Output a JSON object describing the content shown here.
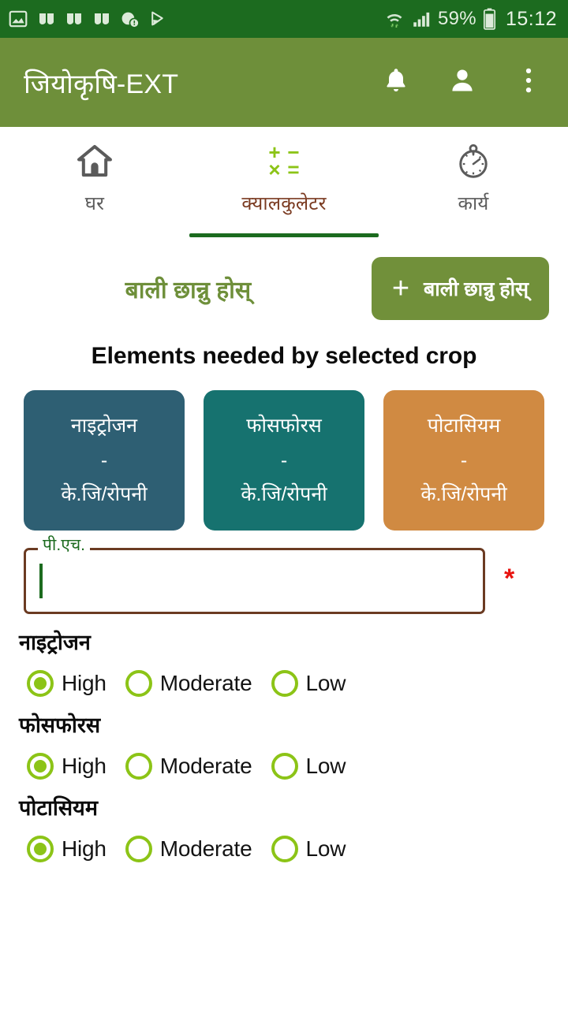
{
  "statusbar": {
    "icons_left": [
      "screenshot-icon",
      "viber-icon",
      "viber-icon",
      "viber-icon",
      "app-info-icon",
      "play-store-icon"
    ],
    "wifi_icon": "wifi-icon",
    "signal_icon": "cellular-signal-icon",
    "battery_percent": "59%",
    "battery_icon": "battery-icon",
    "time": "15:12"
  },
  "appbar": {
    "title": "जियोकृषि-EXT",
    "notification_icon": "bell-icon",
    "profile_icon": "person-icon",
    "overflow_icon": "more-vertical-icon"
  },
  "tabs": [
    {
      "label": "घर",
      "icon": "home-icon",
      "active": false
    },
    {
      "label": "क्यालकुलेटर",
      "icon": "calculator-icon",
      "active": true
    },
    {
      "label": "कार्य",
      "icon": "stopwatch-icon",
      "active": false
    }
  ],
  "calculator_icon_glyphs": {
    "plus": "+",
    "minus": "−",
    "times": "×",
    "equals": "="
  },
  "crop": {
    "selected_title": "बाली छान्नु होस्",
    "add_button_label": "बाली छान्नु होस्",
    "add_button_icon": "plus-icon"
  },
  "section": {
    "heading": "Elements needed by selected crop"
  },
  "nutrient_cards": [
    {
      "name": "नाइट्रोजन",
      "value": "-",
      "unit": "के.जि/रोपनी",
      "color": "#2E5F73"
    },
    {
      "name": "फोसफोरस",
      "value": "-",
      "unit": "के.जि/रोपनी",
      "color": "#16726F"
    },
    {
      "name": "पोटासियम",
      "value": "-",
      "unit": "के.जि/रोपनी",
      "color": "#D08A42"
    }
  ],
  "ph_field": {
    "label": "पी.एच.",
    "value": "",
    "placeholder": "",
    "required_marker": "*",
    "border_color": "#6B3B22",
    "label_color": "#1C6B1F",
    "required_color": "#E8130F"
  },
  "radio_groups": [
    {
      "title": "नाइट्रोजन",
      "options": [
        {
          "label": "High",
          "selected": true
        },
        {
          "label": "Moderate",
          "selected": false
        },
        {
          "label": "Low",
          "selected": false
        }
      ]
    },
    {
      "title": "फोसफोरस",
      "options": [
        {
          "label": "High",
          "selected": true
        },
        {
          "label": "Moderate",
          "selected": false
        },
        {
          "label": "Low",
          "selected": false
        }
      ]
    },
    {
      "title": "पोटासियम",
      "options": [
        {
          "label": "High",
          "selected": true
        },
        {
          "label": "Moderate",
          "selected": false
        },
        {
          "label": "Low",
          "selected": false
        }
      ]
    }
  ],
  "colors": {
    "statusbar": "#1C6B1F",
    "appbar": "#6E8F3A",
    "accent_green": "#8CC417",
    "tab_active_text": "#7A3A20",
    "tab_indicator": "#1C6B1F"
  }
}
